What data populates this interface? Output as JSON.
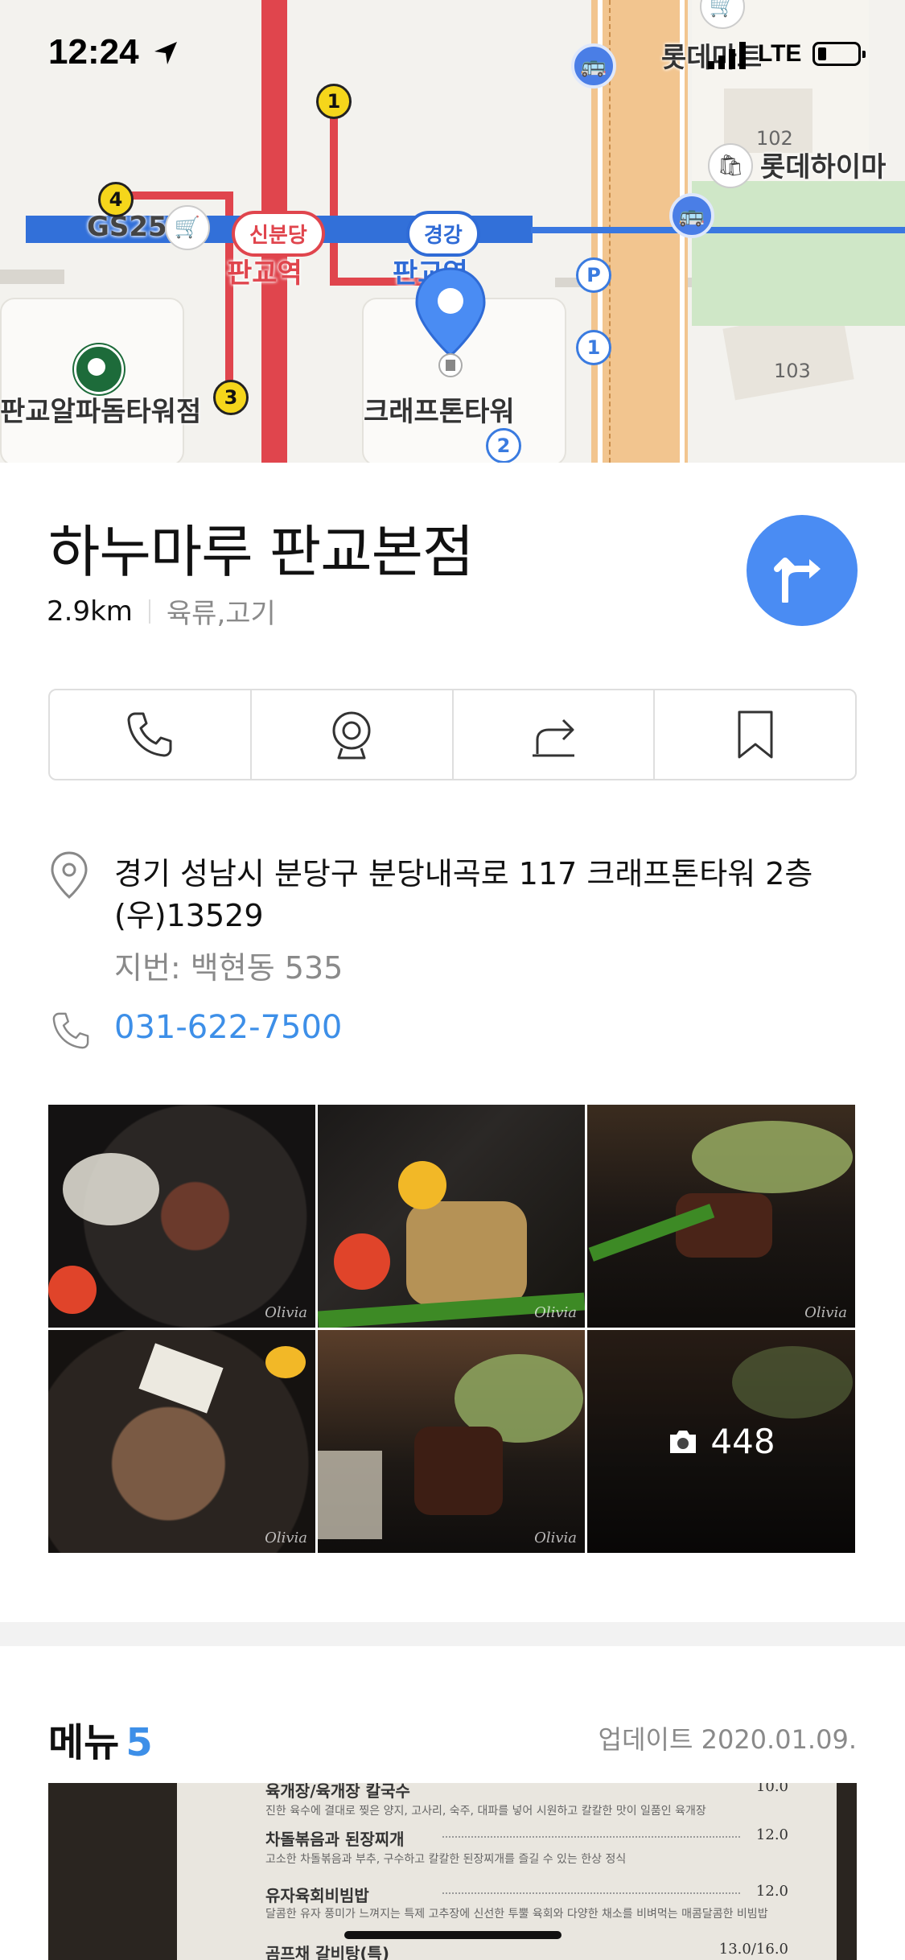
{
  "status_bar": {
    "time": "12:24",
    "network": "LTE"
  },
  "map": {
    "labels": {
      "lotte_mart": "롯데마트",
      "lotte_himart": "롯데하이마",
      "gs25": "GS25",
      "pangyo_station_red": "판교역",
      "pangyo_station_blue": "판교역",
      "line_sinbundang": "신분당",
      "line_gyeonggang": "경강",
      "starbucks_branch": "판교알파돔타워점",
      "kraftone_tower": "크래프톤타워",
      "bldg_102": "102",
      "bldg_103": "103"
    },
    "exits": [
      "1",
      "4",
      "3",
      "1",
      "2"
    ],
    "parking": "P"
  },
  "place": {
    "name": "하누마루 판교본점",
    "distance": "2.9km",
    "category": "육류,고기",
    "address": "경기 성남시 분당구 분당내곡로 117 크래프톤타워 2층 (우)13529",
    "jibun": "지번: 백현동 535",
    "phone": "031-622-7500"
  },
  "actions": [
    {
      "icon": "phone-icon"
    },
    {
      "icon": "street-view-icon"
    },
    {
      "icon": "share-icon"
    },
    {
      "icon": "bookmark-icon"
    }
  ],
  "photos": {
    "count": "448",
    "watermark": "Olivia"
  },
  "menu": {
    "title": "메뉴",
    "count": "5",
    "updated": "업데이트 2020.01.09.",
    "items": [
      {
        "name": "육개장/육개장 칼국수",
        "desc": "진한 육수에 결대로 찢은 양지, 고사리, 숙주, 대파를 넣어 시원하고 칼칼한 맛이 일품인 육개장",
        "price": "10.0"
      },
      {
        "name": "차돌볶음과 된장찌개",
        "desc": "고소한 차돌볶음과 부추, 구수하고 칼칼한 된장찌개를 즐길 수 있는 한상 정식",
        "price": "12.0"
      },
      {
        "name": "유자육회비빔밥",
        "desc": "달콤한 유자 풍미가 느껴지는 특제 고추장에 신선한 투뿔 육회와 다양한 채소를 비벼먹는 매콤달콤한 비빔밥",
        "price": "12.0"
      },
      {
        "name": "곰프채 갈비탕(특)",
        "desc": "",
        "price": "13.0/16.0"
      }
    ]
  },
  "colors": {
    "accent": "#3d8fe8",
    "route_button": "#4a8cf3",
    "line_red": "#e0454d",
    "line_blue": "#3270d9"
  }
}
